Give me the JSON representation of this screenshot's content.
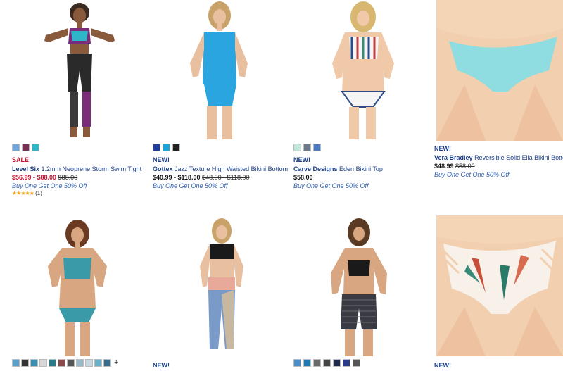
{
  "colors": {
    "sale_red": "#c8102e",
    "new_blue": "#1a3f8b",
    "link_blue": "#2f5fb0",
    "star": "#f5a623"
  },
  "products": [
    {
      "badge": "SALE",
      "brand": "Level Six",
      "name": "1.2mm Neoprene Storm Swim Tight",
      "price_range": "$56.99 - $88.00",
      "original_price": "$88.00",
      "promo": "Buy One Get One 50% Off",
      "rating_stars": 5,
      "rating_count": "(1)",
      "swatches": [
        "#6fa8dc",
        "#7a2e55",
        "#2fb5c9"
      ]
    },
    {
      "badge": "NEW!",
      "brand": "Gottex",
      "name": "Jazz Texture High Waisted Bikini Bottom",
      "price_range": "$40.99 - $118.00",
      "original_price": "$48.00 - $118.00",
      "promo": "Buy One Get One 50% Off",
      "swatches": [
        "#1e3fa0",
        "#1ea3d8",
        "#222222"
      ]
    },
    {
      "badge": "NEW!",
      "brand": "Carve Designs",
      "name": "Eden Bikini Top",
      "price_range": "$58.00",
      "original_price": "",
      "promo": "Buy One Get One 50% Off",
      "swatches": [
        "#bfe7dc",
        "#6d7a8a",
        "#4a7bc4"
      ]
    },
    {
      "badge": "NEW!",
      "brand": "Vera Bradley",
      "name": "Reversible Solid Ella Bikini Bottom",
      "price_range": "$48.99",
      "original_price": "$58.00",
      "promo": "Buy One Get One 50% Off",
      "swatches": []
    },
    {
      "swatches": [
        "#5aa0c8",
        "#333333",
        "#3a8fb0",
        "#d8d8d8",
        "#2a7a8a",
        "#8a4a4a",
        "#555555",
        "#9ab8c8",
        "#c8d8e0",
        "#6ab0c8",
        "#3a6a8a"
      ],
      "swatch_more": "+"
    },
    {
      "badge": "NEW!"
    },
    {
      "swatches": [
        "#4a8fc8",
        "#1e7ab0",
        "#6a6a6a",
        "#444444",
        "#1e2a4a",
        "#2a3a8a",
        "#555555"
      ]
    },
    {
      "badge": "NEW!"
    }
  ]
}
